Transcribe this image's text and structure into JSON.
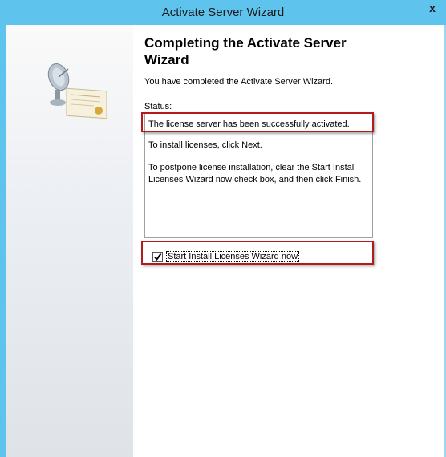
{
  "window": {
    "title": "Activate Server Wizard",
    "close_glyph": "x"
  },
  "content": {
    "heading": "Completing the Activate Server Wizard",
    "intro": "You have completed the Activate Server Wizard.",
    "status_label": "Status:",
    "status_lines": [
      "The license server has been successfully activated.",
      "To install licenses, click Next.",
      "To postpone license installation, clear the Start Install Licenses Wizard now check box, and then click Finish."
    ],
    "checkbox": {
      "label": "Start Install Licenses Wizard now",
      "checked": true
    }
  },
  "colors": {
    "titlebar": "#5ec4ee",
    "highlight": "#b31b1b"
  },
  "icons": [
    "satellite-dish-icon",
    "certificate-icon",
    "checkmark-icon",
    "close-icon"
  ]
}
